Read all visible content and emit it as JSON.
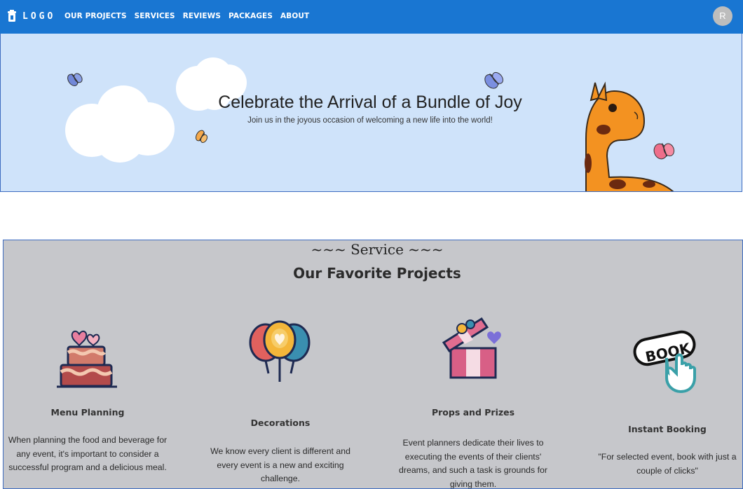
{
  "navbar": {
    "logo_text": "LOGO",
    "logo_icon": "mug-icon",
    "links": [
      "OUR PROJECTS",
      "SERVICES",
      "REVIEWS",
      "PACKAGES",
      "ABOUT"
    ],
    "avatar_initial": "R",
    "color": "#1976d2"
  },
  "hero": {
    "title": "Celebrate the Arrival of a Bundle of Joy",
    "subtitle": "Join us in the joyous occasion of welcoming a new life into the world!",
    "background": "#cfe3fa",
    "decorations": [
      "cloud",
      "cloud",
      "butterfly",
      "butterfly",
      "butterfly",
      "butterfly",
      "giraffe"
    ]
  },
  "services": {
    "overline": "~~~ Service ~~~",
    "heading": "Our Favorite Projects",
    "background": "#c6c7cb",
    "cards": [
      {
        "icon": "cake-icon",
        "title": "Menu Planning",
        "description": "When planning the food and beverage for any event, it's important to consider a successful program and a delicious meal."
      },
      {
        "icon": "balloons-icon",
        "title": "Decorations",
        "description": "We know every client is different and every event is a new and exciting challenge."
      },
      {
        "icon": "gift-box-icon",
        "title": "Props and Prizes",
        "description": "Event planners dedicate their lives to executing the events of their clients' dreams, and such a task is grounds for giving them."
      },
      {
        "icon": "book-button-icon",
        "title": "Instant Booking",
        "description": "\"For selected event, book with just a couple of clicks\""
      }
    ]
  }
}
